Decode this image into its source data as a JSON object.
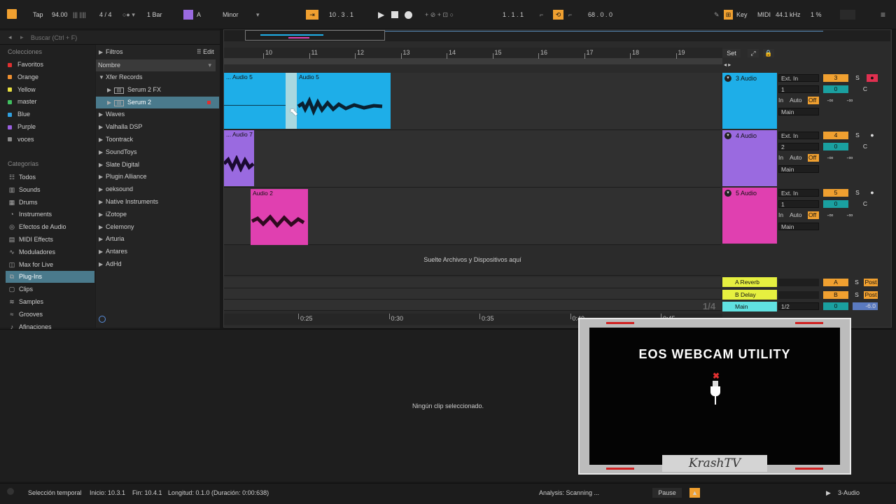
{
  "topbar": {
    "tap": "Tap",
    "tempo": "94.00",
    "signature": "4 / 4",
    "quantize": "1 Bar",
    "key": "A",
    "scale": "Minor",
    "position": "10 .  3 .  1",
    "loop_start": "1 .  1 .  1",
    "loop_len": "68 .  0 .  0",
    "key_label": "Key",
    "midi_label": "MIDI",
    "sample_rate": "44.1 kHz",
    "cpu": "1 %"
  },
  "search": {
    "placeholder": "Buscar (Ctrl + F)"
  },
  "collections": {
    "title": "Colecciones",
    "items": [
      {
        "label": "Favoritos",
        "color": "#e03030"
      },
      {
        "label": "Orange",
        "color": "#f09030"
      },
      {
        "label": "Yellow",
        "color": "#e8e040"
      },
      {
        "label": "master",
        "color": "#40c060"
      },
      {
        "label": "Blue",
        "color": "#30a0e0"
      },
      {
        "label": "Purple",
        "color": "#9a60e0"
      },
      {
        "label": "voces",
        "color": "#888888"
      }
    ]
  },
  "categories": {
    "title": "Categorías",
    "items": [
      {
        "label": "Todos",
        "icon": "grid-icon"
      },
      {
        "label": "Sounds",
        "icon": "sounds-icon"
      },
      {
        "label": "Drums",
        "icon": "drums-icon"
      },
      {
        "label": "Instruments",
        "icon": "instruments-icon"
      },
      {
        "label": "Efectos de Audio",
        "icon": "audio-fx-icon"
      },
      {
        "label": "MIDI Effects",
        "icon": "midi-fx-icon"
      },
      {
        "label": "Moduladores",
        "icon": "modulators-icon"
      },
      {
        "label": "Max for Live",
        "icon": "max-icon"
      },
      {
        "label": "Plug-Ins",
        "icon": "plugin-icon"
      },
      {
        "label": "Clips",
        "icon": "clips-icon"
      },
      {
        "label": "Samples",
        "icon": "samples-icon"
      },
      {
        "label": "Grooves",
        "icon": "grooves-icon"
      },
      {
        "label": "Afinaciones",
        "icon": "tunings-icon"
      }
    ]
  },
  "browser": {
    "filters": "Filtros",
    "edit": "Edit",
    "column": "Nombre",
    "items": [
      {
        "label": "Xfer Records",
        "level": 0,
        "open": true
      },
      {
        "label": "Serum 2 FX",
        "level": 1,
        "open": false
      },
      {
        "label": "Serum 2",
        "level": 1,
        "open": false,
        "selected": true
      },
      {
        "label": "Waves",
        "level": 0
      },
      {
        "label": "Valhalla DSP",
        "level": 0
      },
      {
        "label": "Toontrack",
        "level": 0
      },
      {
        "label": "SoundToys",
        "level": 0
      },
      {
        "label": "Slate Digital",
        "level": 0
      },
      {
        "label": "Plugin Alliance",
        "level": 0
      },
      {
        "label": "oeksound",
        "level": 0
      },
      {
        "label": "Native Instruments",
        "level": 0
      },
      {
        "label": "iZotope",
        "level": 0
      },
      {
        "label": "Celemony",
        "level": 0
      },
      {
        "label": "Arturia",
        "level": 0
      },
      {
        "label": "Antares",
        "level": 0
      },
      {
        "label": "AdHd",
        "level": 0
      }
    ]
  },
  "ruler": {
    "bars": [
      "10",
      "11",
      "12",
      "13",
      "14",
      "15",
      "16",
      "17",
      "18",
      "19"
    ],
    "set": "Set",
    "times": [
      "0:25",
      "0:30",
      "0:35",
      "0:40",
      "0:45"
    ]
  },
  "clips": [
    {
      "label": "... Audio 5",
      "color": "#1eaee8"
    },
    {
      "label": "Audio 5",
      "color": "#1eaee8"
    },
    {
      "label": "... Audio 7",
      "color": "#9a6ae0"
    },
    {
      "label": "Audio 2",
      "color": "#e040b0"
    }
  ],
  "drop_text": "Suelte Archivos y Dispositivos aquí",
  "tracks": [
    {
      "name": "3 Audio",
      "color": "#1eaee8",
      "input": "Ext. In",
      "channel": "1",
      "in": "In",
      "auto": "Auto",
      "off": "Off",
      "out": "Main",
      "number": "3",
      "vol": "0",
      "pan": "C",
      "s": "S",
      "inf1": "-∞",
      "inf2": "-∞"
    },
    {
      "name": "4 Audio",
      "color": "#9a6ae0",
      "input": "Ext. In",
      "channel": "2",
      "in": "In",
      "auto": "Auto",
      "off": "Off",
      "out": "Main",
      "number": "4",
      "vol": "0",
      "pan": "C",
      "s": "S",
      "inf1": "-∞",
      "inf2": "-∞"
    },
    {
      "name": "5 Audio",
      "color": "#e040b0",
      "input": "Ext. In",
      "channel": "1",
      "in": "In",
      "auto": "Auto",
      "off": "Off",
      "out": "Main",
      "number": "5",
      "vol": "0",
      "pan": "C",
      "s": "S",
      "inf1": "-∞",
      "inf2": "-∞"
    }
  ],
  "returns": [
    {
      "name": "A Reverb",
      "letter": "A",
      "s": "S",
      "post": "Post",
      "color": "#e6f040"
    },
    {
      "name": "B Delay",
      "letter": "B",
      "s": "S",
      "post": "Post",
      "color": "#e6f040"
    }
  ],
  "main": {
    "name": "Main",
    "out": "1/2",
    "vol": "0",
    "db": "-6.0",
    "fraction": "1/4",
    "color": "#60e0e0"
  },
  "detail": {
    "empty": "Ningún clip seleccionado."
  },
  "status": {
    "mode": "Selección temporal",
    "start": "Inicio: 10.3.1",
    "end": "Fin: 10.4.1",
    "length": "Longitud: 0.1.0  (Duración: 0:00:638)",
    "analysis": "Analysis: Scanning ...",
    "pause": "Pause",
    "track": "3-Audio"
  },
  "webcam": {
    "title": "EOS WEBCAM UTILITY",
    "watermark": "KrashTV"
  }
}
